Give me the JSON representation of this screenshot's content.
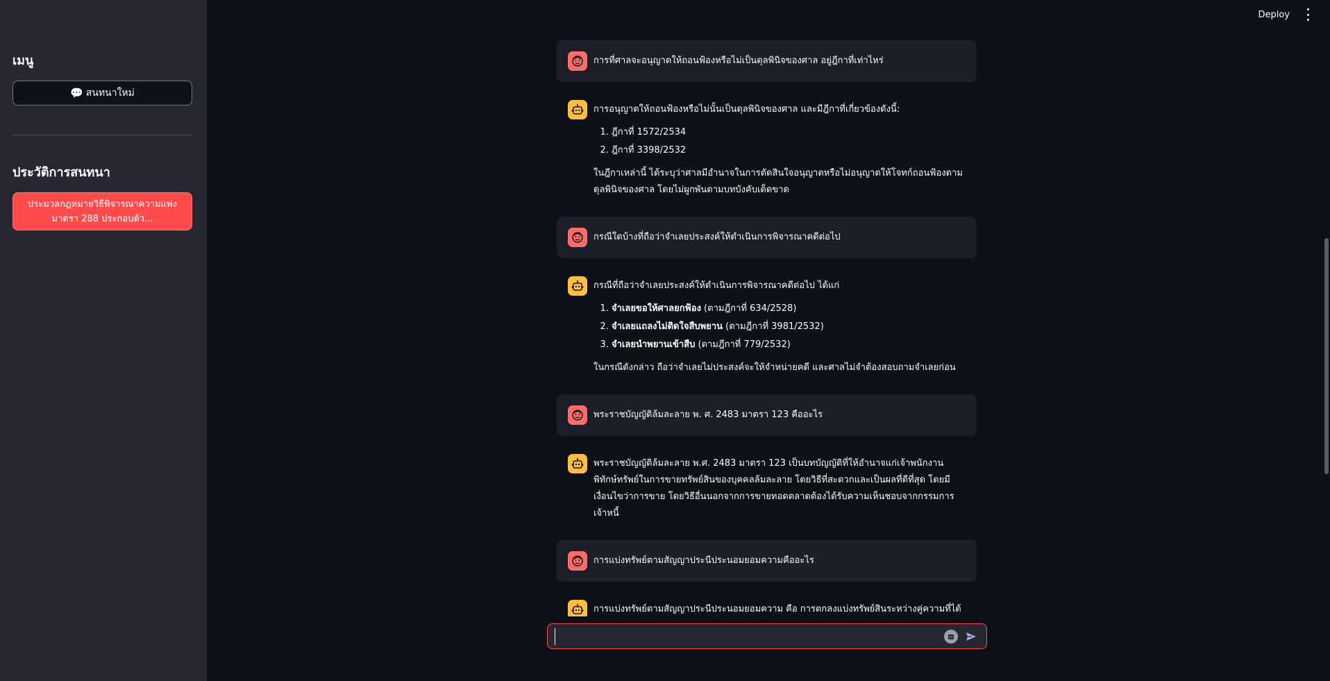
{
  "topbar": {
    "deploy_label": "Deploy"
  },
  "sidebar": {
    "menu_title": "เมนู",
    "new_chat_icon": "💬",
    "new_chat_label": "สนทนาใหม่",
    "history_title": "ประวัติการสนทนา",
    "history_items": [
      {
        "label": "ประมวลกฎหมายวิธีพิจารณาความแพ่ง มาตรา 288 ประกอบด้ว..."
      }
    ]
  },
  "messages": [
    {
      "role": "user",
      "text": "การที่ศาลจะอนุญาตให้ถอนฟ้องหรือไม่เป็นดุลพินิจของศาล อยู่ฎีกาที่เท่าไหร่"
    },
    {
      "role": "assistant",
      "intro": "การอนุญาตให้ถอนฟ้องหรือไม่นั้นเป็นดุลพินิจของศาล และมีฎีกาที่เกี่ยวข้องดังนี้:",
      "items": [
        {
          "bold": "",
          "text": "ฎีกาที่ 1572/2534"
        },
        {
          "bold": "",
          "text": "ฎีกาที่ 3398/2532"
        }
      ],
      "outro": "ในฎีกาเหล่านี้ ได้ระบุว่าศาลมีอำนาจในการตัดสินใจอนุญาตหรือไม่อนุญาตให้โจทก์ถอนฟ้องตามดุลพินิจของศาล โดยไม่ผูกพันตามบทบังคับเด็ดขาด"
    },
    {
      "role": "user",
      "text": "กรณีใดบ้างที่ถือว่าจำเลยประสงค์ให้ดำเนินการพิจารณาคดีต่อไป"
    },
    {
      "role": "assistant",
      "intro": "กรณีที่ถือว่าจำเลยประสงค์ให้ดำเนินการพิจารณาคดีต่อไป ได้แก่",
      "items": [
        {
          "bold": "จำเลยขอให้ศาลยกฟ้อง",
          "text": " (ตามฎีกาที่ 634/2528)"
        },
        {
          "bold": "จำเลยแถลงไม่ติดใจสืบพยาน",
          "text": " (ตามฎีกาที่ 3981/2532)"
        },
        {
          "bold": "จำเลยนำพยานเข้าสืบ",
          "text": " (ตามฎีกาที่ 779/2532)"
        }
      ],
      "outro": "ในกรณีดังกล่าว ถือว่าจำเลยไม่ประสงค์จะให้จำหน่ายคดี และศาลไม่จำต้องสอบถามจำเลยก่อน"
    },
    {
      "role": "user",
      "text": "พระราชบัญญัติล้มละลาย พ. ศ. 2483 มาตรา 123 คืออะไร"
    },
    {
      "role": "assistant",
      "intro": "พระราชบัญญัติล้มละลาย พ.ศ. 2483 มาตรา 123 เป็นบทบัญญัติที่ให้อำนาจแก่เจ้าพนักงานพิทักษ์ทรัพย์ในการขายทรัพย์สินของบุคคลล้มละลาย โดยวิธีที่สะดวกและเป็นผลที่ดีที่สุด โดยมีเงื่อนไขว่าการขาย โดยวิธีอื่นนอกจากการขายทอดตลาดต้องได้รับความเห็นชอบจากกรรมการเจ้าหนี้",
      "items": [],
      "outro": ""
    },
    {
      "role": "user",
      "text": "การแบ่งทรัพย์ตามสัญญาประนีประนอมยอมความคืออะไร"
    },
    {
      "role": "assistant",
      "intro": "การแบ่งทรัพย์ตามสัญญาประนีประนอมยอมความ คือ การตกลงแบ่งทรัพย์สินระหว่างคู่ความที่ได้",
      "items": [],
      "outro": ""
    }
  ],
  "input": {
    "placeholder": "",
    "value": ""
  },
  "colors": {
    "accent": "#ff4b4b",
    "user_avatar": "#ff6c6c",
    "bot_avatar": "#ffbd45",
    "sidebar_bg": "#262730",
    "main_bg": "#0e1117"
  },
  "icons": {
    "user_avatar": "face-icon",
    "bot_avatar": "robot-icon",
    "attach": "attach-icon",
    "send": "send-icon",
    "menu": "kebab-menu-icon",
    "new_chat": "speech-bubble-icon"
  }
}
